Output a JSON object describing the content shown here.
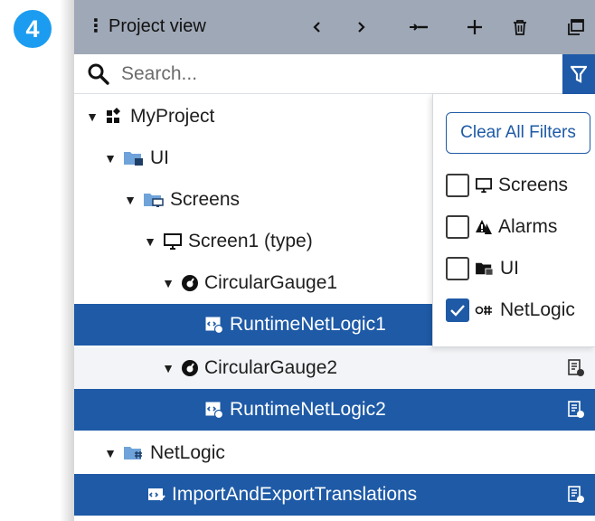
{
  "step_badge": "4",
  "header": {
    "title": "Project view"
  },
  "search": {
    "placeholder": "Search..."
  },
  "tree": {
    "my_project": "MyProject",
    "ui": "UI",
    "screens": "Screens",
    "screen1": "Screen1 (type)",
    "gauge1": "CircularGauge1",
    "netlogic1": "RuntimeNetLogic1",
    "gauge2": "CircularGauge2",
    "netlogic2": "RuntimeNetLogic2",
    "netlogic_folder": "NetLogic",
    "import_export": "ImportAndExportTranslations"
  },
  "filter_panel": {
    "clear_label": "Clear All Filters",
    "options": [
      {
        "label": "Screens",
        "checked": false
      },
      {
        "label": "Alarms",
        "checked": false
      },
      {
        "label": "UI",
        "checked": false
      },
      {
        "label": "NetLogic",
        "checked": true
      }
    ]
  },
  "colors": {
    "header_bg": "#9fa8b6",
    "selected_bg": "#1e5aa6",
    "filter_btn_bg": "#1f5aa8",
    "badge_bg": "#1c9cf0"
  }
}
